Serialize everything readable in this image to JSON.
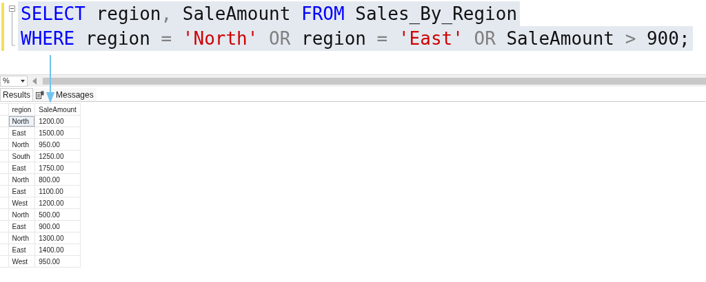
{
  "editor": {
    "lines": [
      {
        "selected": true,
        "tokens": [
          {
            "kind": "keyword",
            "text": "SELECT"
          },
          {
            "kind": "plain",
            "text": " region"
          },
          {
            "kind": "operator",
            "text": ","
          },
          {
            "kind": "plain",
            "text": " SaleAmount "
          },
          {
            "kind": "keyword",
            "text": "FROM"
          },
          {
            "kind": "plain",
            "text": " Sales_By_Region"
          }
        ]
      },
      {
        "selected": true,
        "tokens": [
          {
            "kind": "keyword",
            "text": "WHERE"
          },
          {
            "kind": "plain",
            "text": " region "
          },
          {
            "kind": "operator",
            "text": "="
          },
          {
            "kind": "string",
            "text": " 'North'"
          },
          {
            "kind": "operator",
            "text": " OR"
          },
          {
            "kind": "plain",
            "text": " region "
          },
          {
            "kind": "operator",
            "text": "="
          },
          {
            "kind": "string",
            "text": " 'East'"
          },
          {
            "kind": "operator",
            "text": " OR"
          },
          {
            "kind": "plain",
            "text": " SaleAmount "
          },
          {
            "kind": "operator",
            "text": ">"
          },
          {
            "kind": "plain",
            "text": " 900;"
          }
        ]
      }
    ]
  },
  "zoom": {
    "value": "%"
  },
  "tabs": [
    {
      "label": "Results",
      "selected": true
    },
    {
      "label": "Messages",
      "selected": false
    }
  ],
  "grid": {
    "columns": [
      "region",
      "SaleAmount"
    ],
    "rows": [
      {
        "cells": [
          "North",
          "1200.00"
        ],
        "focused": true
      },
      {
        "cells": [
          "East",
          "1500.00"
        ],
        "focused": false
      },
      {
        "cells": [
          "North",
          "950.00"
        ],
        "focused": false
      },
      {
        "cells": [
          "South",
          "1250.00"
        ],
        "focused": false
      },
      {
        "cells": [
          "East",
          "1750.00"
        ],
        "focused": false
      },
      {
        "cells": [
          "North",
          "800.00"
        ],
        "focused": false
      },
      {
        "cells": [
          "East",
          "1100.00"
        ],
        "focused": false
      },
      {
        "cells": [
          "West",
          "1200.00"
        ],
        "focused": false
      },
      {
        "cells": [
          "North",
          "500.00"
        ],
        "focused": false
      },
      {
        "cells": [
          "East",
          "900.00"
        ],
        "focused": false
      },
      {
        "cells": [
          "North",
          "1300.00"
        ],
        "focused": false
      },
      {
        "cells": [
          "East",
          "1400.00"
        ],
        "focused": false
      },
      {
        "cells": [
          "West",
          "950.00"
        ],
        "focused": false
      }
    ]
  }
}
